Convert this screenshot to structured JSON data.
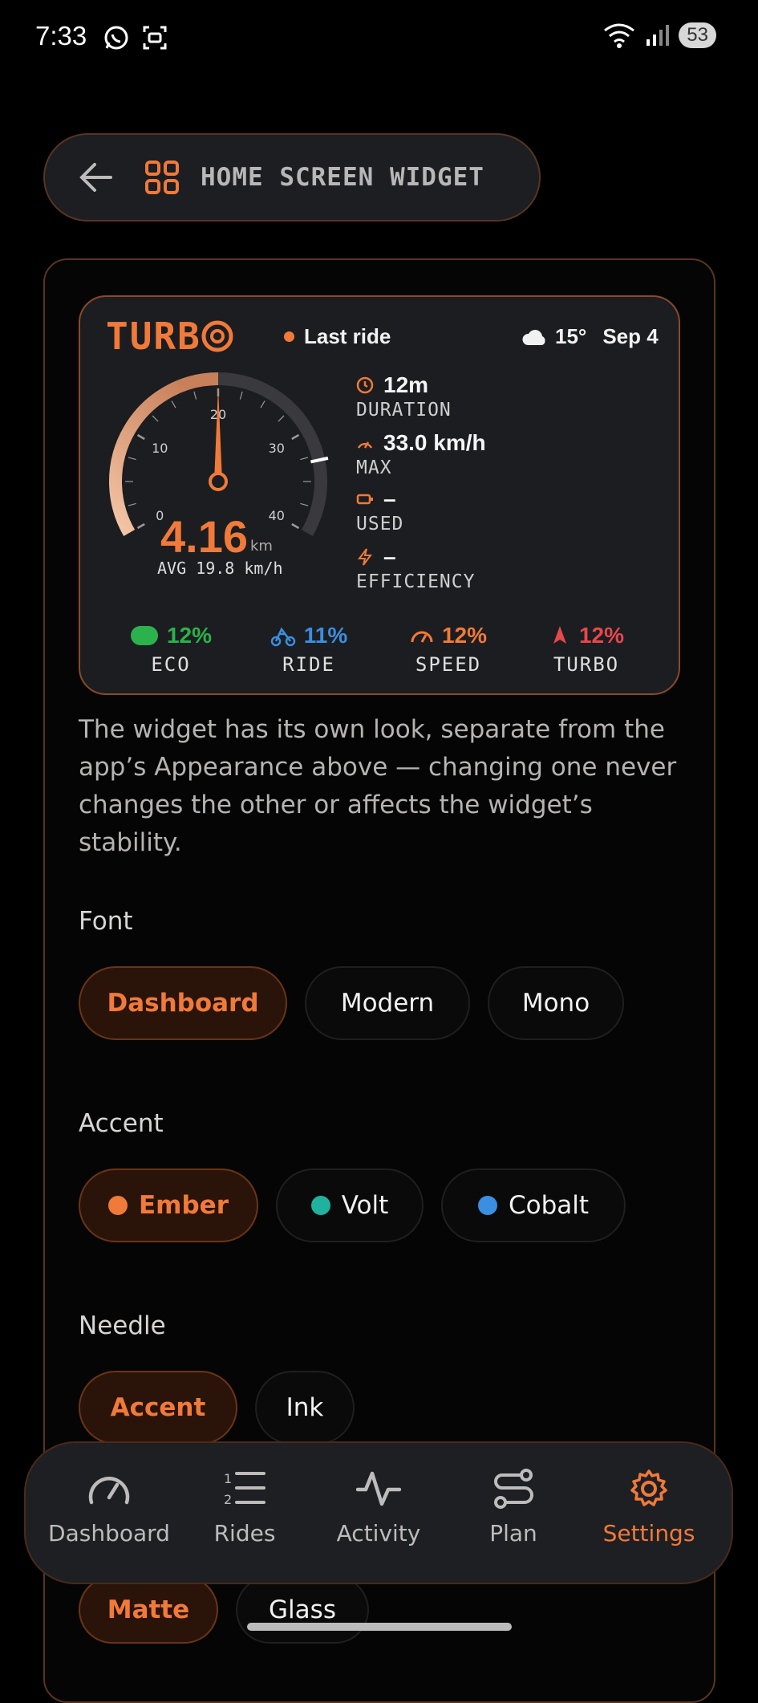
{
  "status_bar": {
    "time": "7:33",
    "battery": "53"
  },
  "header": {
    "title": "HOME SCREEN WIDGET"
  },
  "widget": {
    "logo": "TURB",
    "last_ride": "Last ride",
    "temperature": "15°",
    "date": "Sep 4",
    "gauge": {
      "ticks": [
        "0",
        "10",
        "20",
        "30",
        "40"
      ],
      "value_kmh": 20,
      "max_mark_kmh": 33
    },
    "distance": "4.16",
    "distance_unit": "km",
    "avg": "AVG 19.8 km/h",
    "stats": [
      {
        "value": "12m",
        "label": "DURATION"
      },
      {
        "value": "33.0 km/h",
        "label": "MAX"
      },
      {
        "value": "–",
        "label": "USED"
      },
      {
        "value": "–",
        "label": "EFFICIENCY"
      }
    ],
    "modes": [
      {
        "value": "12%",
        "label": "ECO",
        "color": "#2bb24c"
      },
      {
        "value": "11%",
        "label": "RIDE",
        "color": "#3b8fe0"
      },
      {
        "value": "12%",
        "label": "SPEED",
        "color": "#f07a3a"
      },
      {
        "value": "12%",
        "label": "TURBO",
        "color": "#e5484d"
      }
    ]
  },
  "description": "The widget has its own look, separate from the app’s Appearance above — changing one never changes the other or affects the widget’s stability.",
  "font_section": {
    "label": "Font",
    "options": [
      "Dashboard",
      "Modern",
      "Mono"
    ],
    "selected": "Dashboard"
  },
  "accent_section": {
    "label": "Accent",
    "options": [
      {
        "name": "Ember",
        "color": "#f07a3a"
      },
      {
        "name": "Volt",
        "color": "#20b2a0"
      },
      {
        "name": "Cobalt",
        "color": "#3b8fe0"
      }
    ],
    "selected": "Ember"
  },
  "needle_section": {
    "label": "Needle",
    "options": [
      "Accent",
      "Ink"
    ],
    "selected": "Accent"
  },
  "finish_section": {
    "options": [
      "Matte",
      "Glass"
    ],
    "selected": "Matte"
  },
  "nav": {
    "items": [
      {
        "label": "Dashboard",
        "icon": "gauge-icon"
      },
      {
        "label": "Rides",
        "icon": "list-icon"
      },
      {
        "label": "Activity",
        "icon": "pulse-icon"
      },
      {
        "label": "Plan",
        "icon": "route-icon"
      },
      {
        "label": "Settings",
        "icon": "gear-icon"
      }
    ],
    "active": "Settings"
  },
  "colors": {
    "accent": "#f07a3a",
    "border": "#5a3420",
    "background": "#000000"
  }
}
